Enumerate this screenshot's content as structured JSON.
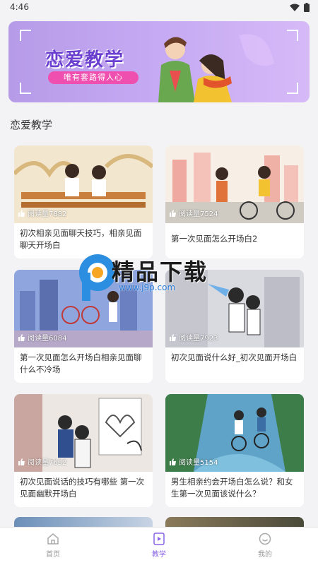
{
  "status": {
    "time": "4:46"
  },
  "banner": {
    "title": "恋爱教学",
    "subtitle": "唯有套路得人心"
  },
  "section": {
    "title": "恋爱教学"
  },
  "articles": [
    {
      "reads": "阅读量7882",
      "title": "初次相亲见面聊天技巧，相亲见面聊天开场白"
    },
    {
      "reads": "阅读量7524",
      "title": "第一次见面怎么开场白2"
    },
    {
      "reads": "阅读量6084",
      "title": "第一次见面怎么开场白相亲见面聊什么不冷场"
    },
    {
      "reads": "阅读量7923",
      "title": "初次见面说什么好_初次见面开场白"
    },
    {
      "reads": "阅读量7632",
      "title": "初次见面说话的技巧有哪些 第一次见面幽默开场白"
    },
    {
      "reads": "阅读量5154",
      "title": "男生相亲约会开场白怎么说？和女生第一次见面该说什么？"
    }
  ],
  "watermark": {
    "text": "精品下载",
    "url": "www.j9p.com"
  },
  "tabs": [
    {
      "label": "首页",
      "icon": "home-icon",
      "active": false
    },
    {
      "label": "教学",
      "icon": "play-icon",
      "active": true
    },
    {
      "label": "我的",
      "icon": "smile-icon",
      "active": false
    }
  ],
  "colors": {
    "accent": "#8a63e8",
    "banner_bg": "#c4a8f2",
    "subtitle_pill": "#ef4fae"
  }
}
